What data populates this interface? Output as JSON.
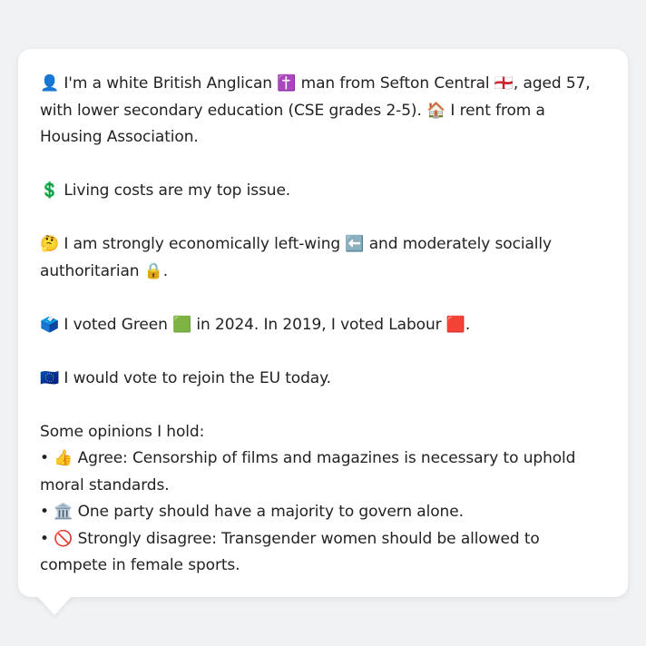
{
  "profile": {
    "intro": "👤 I'm a white British Anglican ✝️ man from Sefton Central 🏴󠁧󠁢󠁥󠁮󠁧󠁿, aged 57, with lower secondary education (CSE grades 2-5). 🏠 I rent from a Housing Association.",
    "top_issue": "💲 Living costs are my top issue.",
    "ideology": "🤔 I am strongly economically left-wing ⬅️ and moderately socially authoritarian 🔒.",
    "votes": "🗳️ I voted Green 🟩 in 2024. In 2019, I voted Labour 🟥.",
    "eu": "🇪🇺 I would vote to rejoin the EU today.",
    "opinions_heading": "Some opinions I hold:",
    "opinions": [
      "• 👍 Agree: Censorship of films and magazines is necessary to uphold moral standards.",
      "• 🏛️ One party should have a majority to govern alone.",
      "• 🚫 Strongly disagree: Transgender women should be allowed to compete in female sports."
    ]
  }
}
